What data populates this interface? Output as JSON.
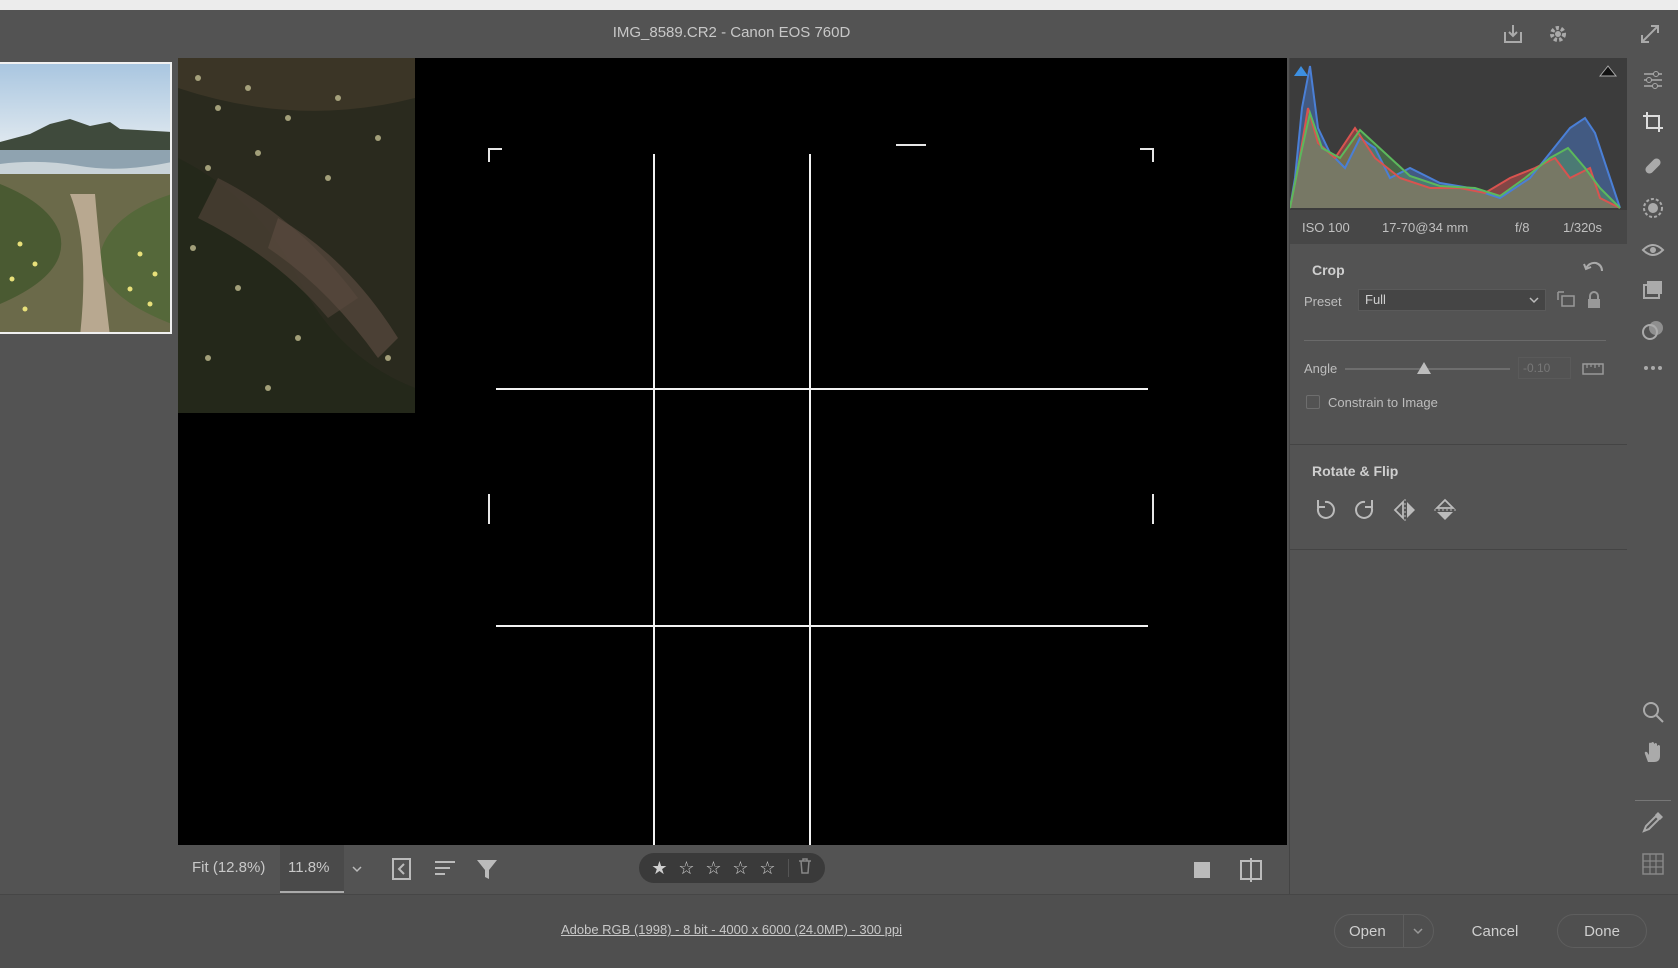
{
  "window": {
    "title": "IMG_8589.CR2  -  Canon EOS 760D"
  },
  "toolbar_icons": [
    "download-icon",
    "gear-icon",
    "expand-icon"
  ],
  "exif": {
    "iso": "ISO 100",
    "lens": "17-70@34 mm",
    "aperture": "f/8",
    "shutter": "1/320s"
  },
  "crop": {
    "title": "Crop",
    "preset_label": "Preset",
    "preset_value": "Full",
    "angle_label": "Angle",
    "angle_value": "-0.10",
    "angle_slider_fraction": 0.48,
    "constrain_label": "Constrain to Image",
    "constrain_checked": false
  },
  "rotate_flip": {
    "title": "Rotate & Flip"
  },
  "bottombar": {
    "fit_label": "Fit (12.8%)",
    "zoom_value": "11.8%",
    "rating": 1,
    "max_rating": 5
  },
  "footer": {
    "info": "Adobe RGB (1998) - 8 bit - 4000 x 6000 (24.0MP) - 300 ppi",
    "open": "Open",
    "cancel": "Cancel",
    "done": "Done"
  },
  "histogram_colors": {
    "red": "#d9534f",
    "green": "#5cb85c",
    "blue": "#4a7fd6",
    "clip_shadow": "#3d8fe0",
    "clip_highlight": "#111111"
  }
}
